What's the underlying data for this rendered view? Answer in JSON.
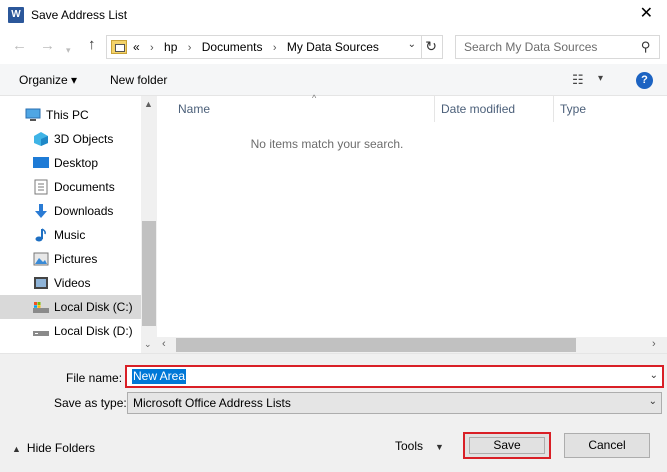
{
  "window": {
    "title": "Save Address List",
    "app_icon_letter": "W"
  },
  "address_bar": {
    "crumbs": [
      "«",
      "hp",
      "Documents",
      "My Data Sources"
    ],
    "separator": "›"
  },
  "search": {
    "placeholder": "Search My Data Sources"
  },
  "toolbar": {
    "organize_label": "Organize ▾",
    "new_folder_label": "New folder",
    "help_label": "?"
  },
  "nav_pane": {
    "items": [
      {
        "label": "This PC",
        "icon": "pc-icon"
      },
      {
        "label": "3D Objects",
        "icon": "3d-objects-icon"
      },
      {
        "label": "Desktop",
        "icon": "desktop-icon"
      },
      {
        "label": "Documents",
        "icon": "documents-icon"
      },
      {
        "label": "Downloads",
        "icon": "downloads-icon"
      },
      {
        "label": "Music",
        "icon": "music-icon"
      },
      {
        "label": "Pictures",
        "icon": "pictures-icon"
      },
      {
        "label": "Videos",
        "icon": "videos-icon"
      },
      {
        "label": "Local Disk (C:)",
        "icon": "local-disk-c-icon",
        "selected": true
      },
      {
        "label": "Local Disk (D:)",
        "icon": "local-disk-d-icon"
      }
    ]
  },
  "file_list": {
    "columns": [
      "Name",
      "Date modified",
      "Type"
    ],
    "empty_message": "No items match your search."
  },
  "form": {
    "file_name_label": "File name:",
    "file_name_value": "New Area",
    "save_type_label": "Save as type:",
    "save_type_value": "Microsoft Office Address Lists"
  },
  "footer": {
    "hide_folders_label": "Hide Folders",
    "tools_label": "Tools",
    "save_label": "Save",
    "cancel_label": "Cancel"
  },
  "colors": {
    "highlight_border": "#d91f26",
    "selection": "#0078d7",
    "help_blue": "#1c63c2"
  }
}
